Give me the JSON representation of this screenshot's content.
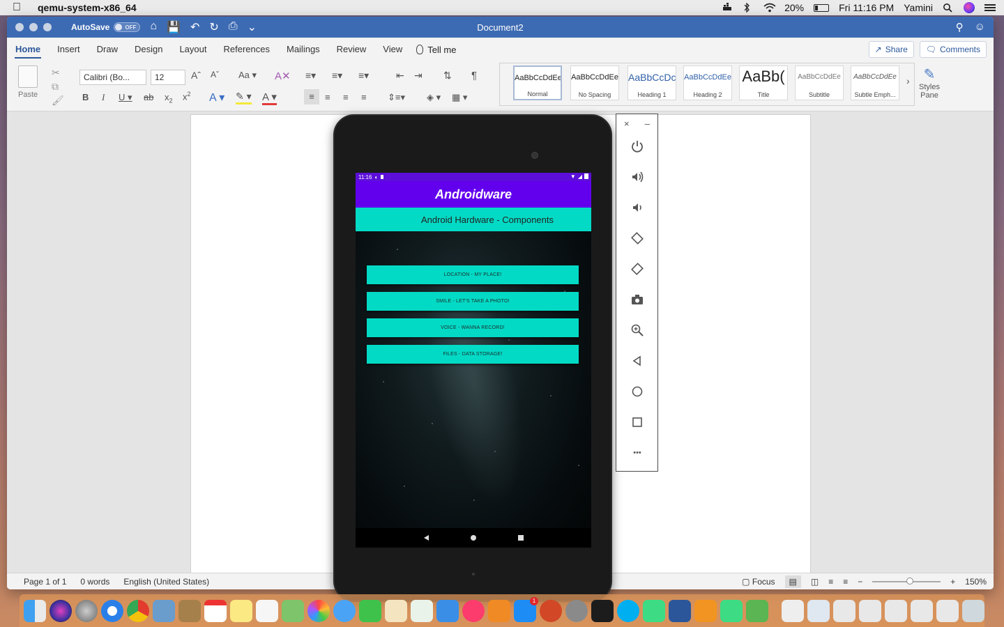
{
  "menubar": {
    "app_name": "qemu-system-x86_64",
    "battery": "20%",
    "clock": "Fri 11:16 PM",
    "user": "Yamini"
  },
  "word": {
    "autosave_label": "AutoSave",
    "autosave_state": "OFF",
    "doc_title": "Document2",
    "tabs": [
      "Home",
      "Insert",
      "Draw",
      "Design",
      "Layout",
      "References",
      "Mailings",
      "Review",
      "View"
    ],
    "tell_me": "Tell me",
    "share": "Share",
    "comments": "Comments",
    "paste_label": "Paste",
    "font_name": "Calibri (Bo...",
    "font_size": "12",
    "styles": [
      {
        "sample": "AaBbCcDdEe",
        "name": "Normal"
      },
      {
        "sample": "AaBbCcDdEe",
        "name": "No Spacing"
      },
      {
        "sample": "AaBbCcDc",
        "name": "Heading 1"
      },
      {
        "sample": "AaBbCcDdEe",
        "name": "Heading 2"
      },
      {
        "sample": "AaBb(",
        "name": "Title"
      },
      {
        "sample": "AaBbCcDdEe",
        "name": "Subtitle"
      },
      {
        "sample": "AaBbCcDdEe",
        "name": "Subtle Emph..."
      }
    ],
    "styles_pane_line1": "Styles",
    "styles_pane_line2": "Pane",
    "status": {
      "page": "Page 1 of 1",
      "words": "0 words",
      "language": "English (United States)",
      "focus": "Focus",
      "zoom": "150%",
      "zoom_level": 0.55
    }
  },
  "emulator": {
    "status_time": "11:16",
    "app_title": "Androidware",
    "subtitle": "Android Hardware - Components",
    "buttons": [
      "LOCATION - MY PLACE!",
      "SMILE - LET'S TAKE A PHOTO!",
      "VOICE - WANNA RECORD!",
      "FILES - DATA STORAGE!"
    ],
    "panel_close": "×",
    "panel_minimize": "–",
    "panel_more": "•••"
  },
  "colors": {
    "word_blue": "#3d6bb3",
    "android_primary": "#6200ee",
    "android_accent": "#03dac5"
  }
}
